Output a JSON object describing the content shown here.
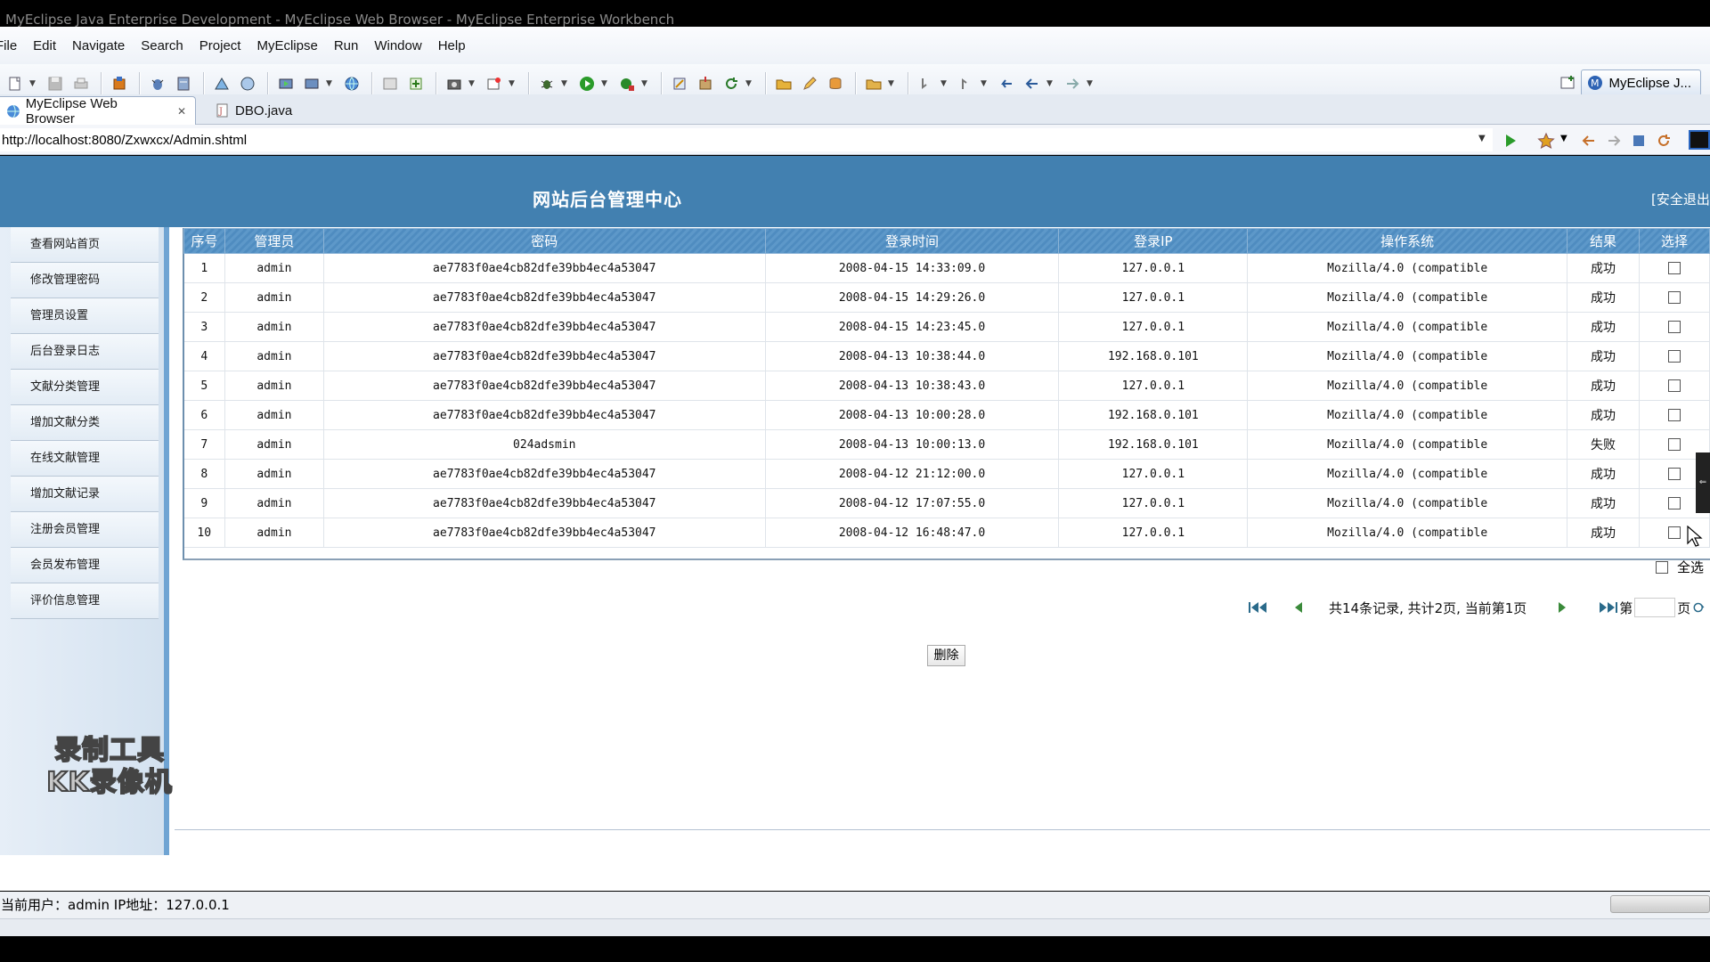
{
  "window": {
    "title": "MyEclipse Java Enterprise Development - MyEclipse Web Browser - MyEclipse Enterprise Workbench"
  },
  "menubar": [
    "File",
    "Edit",
    "Navigate",
    "Search",
    "Project",
    "MyEclipse",
    "Run",
    "Window",
    "Help"
  ],
  "perspective": {
    "label": "MyEclipse J..."
  },
  "tabs": [
    {
      "label": "MyEclipse Web Browser",
      "icon": "globe-icon",
      "active": true
    },
    {
      "label": "DBO.java",
      "icon": "java-file-icon",
      "active": false
    }
  ],
  "browser": {
    "url": "http://localhost:8080/Zxwxcx/Admin.shtml"
  },
  "page": {
    "title": "网站后台管理中心",
    "logout": "[安全退出",
    "sidebar": [
      "查看网站首页",
      "修改管理密码",
      "管理员设置",
      "后台登录日志",
      "文献分类管理",
      "增加文献分类",
      "在线文献管理",
      "增加文献记录",
      "注册会员管理",
      "会员发布管理",
      "评价信息管理"
    ],
    "watermark": [
      "录制工具",
      "KK录像机"
    ],
    "table": {
      "headers": [
        "序号",
        "管理员",
        "密码",
        "登录时间",
        "登录IP",
        "操作系统",
        "结果",
        "选择"
      ],
      "rows": [
        [
          "1",
          "admin",
          "ae7783f0ae4cb82dfe39bb4ec4a53047",
          "2008-04-15 14:33:09.0",
          "127.0.0.1",
          "Mozilla/4.0 (compatible",
          "成功"
        ],
        [
          "2",
          "admin",
          "ae7783f0ae4cb82dfe39bb4ec4a53047",
          "2008-04-15 14:29:26.0",
          "127.0.0.1",
          "Mozilla/4.0 (compatible",
          "成功"
        ],
        [
          "3",
          "admin",
          "ae7783f0ae4cb82dfe39bb4ec4a53047",
          "2008-04-15 14:23:45.0",
          "127.0.0.1",
          "Mozilla/4.0 (compatible",
          "成功"
        ],
        [
          "4",
          "admin",
          "ae7783f0ae4cb82dfe39bb4ec4a53047",
          "2008-04-13 10:38:44.0",
          "192.168.0.101",
          "Mozilla/4.0 (compatible",
          "成功"
        ],
        [
          "5",
          "admin",
          "ae7783f0ae4cb82dfe39bb4ec4a53047",
          "2008-04-13 10:38:43.0",
          "127.0.0.1",
          "Mozilla/4.0 (compatible",
          "成功"
        ],
        [
          "6",
          "admin",
          "ae7783f0ae4cb82dfe39bb4ec4a53047",
          "2008-04-13 10:00:28.0",
          "192.168.0.101",
          "Mozilla/4.0 (compatible",
          "成功"
        ],
        [
          "7",
          "admin",
          "024adsmin",
          "2008-04-13 10:00:13.0",
          "192.168.0.101",
          "Mozilla/4.0 (compatible",
          "失败"
        ],
        [
          "8",
          "admin",
          "ae7783f0ae4cb82dfe39bb4ec4a53047",
          "2008-04-12 21:12:00.0",
          "127.0.0.1",
          "Mozilla/4.0 (compatible",
          "成功"
        ],
        [
          "9",
          "admin",
          "ae7783f0ae4cb82dfe39bb4ec4a53047",
          "2008-04-12 17:07:55.0",
          "127.0.0.1",
          "Mozilla/4.0 (compatible",
          "成功"
        ],
        [
          "10",
          "admin",
          "ae7783f0ae4cb82dfe39bb4ec4a53047",
          "2008-04-12 16:48:47.0",
          "127.0.0.1",
          "Mozilla/4.0 (compatible",
          "成功"
        ]
      ],
      "select_all_label": "全选"
    },
    "pager": {
      "summary": "共14条记录, 共计2页, 当前第1页",
      "page_prefix": "第",
      "page_suffix": "页"
    },
    "delete_button": "删除",
    "status_user": "当前用户：admin  IP地址：127.0.0.1"
  },
  "colors": {
    "banner": "#4280b0",
    "table_header": "#5d98c9",
    "sidebar_border": "#6fa4d3"
  }
}
